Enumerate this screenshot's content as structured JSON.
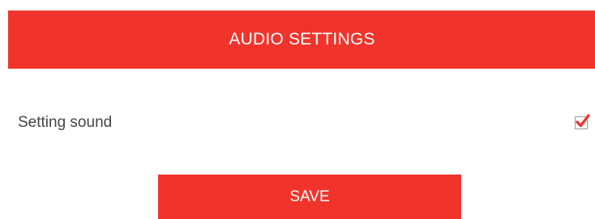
{
  "header": {
    "title": "AUDIO SETTINGS"
  },
  "settings": {
    "items": [
      {
        "label": "Setting sound",
        "checked": true,
        "icon": "checkmark-icon"
      }
    ]
  },
  "actions": {
    "save_label": "SAVE"
  },
  "colors": {
    "accent": "#f1342b",
    "text": "#444444",
    "checkbox_border": "#9a9a9a",
    "background": "#ffffff"
  }
}
